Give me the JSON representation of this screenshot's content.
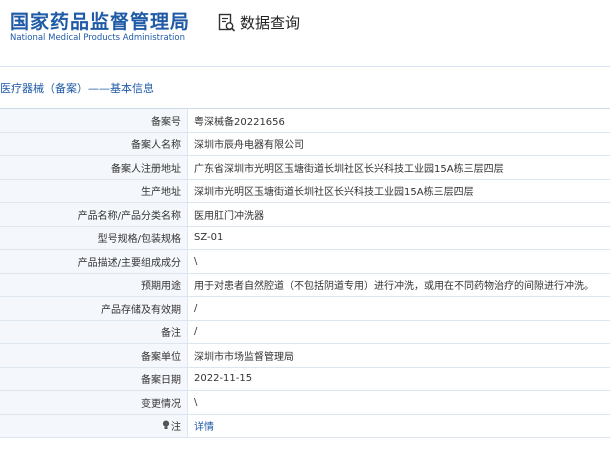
{
  "header": {
    "logo_cn": "国家药品监督管理局",
    "logo_en": "National Medical Products Administration",
    "query_label": "数据查询",
    "query_icon": "document-search-icon"
  },
  "section": {
    "title": "医疗器械（备案）——基本信息"
  },
  "rows": [
    {
      "label": "备案号",
      "value": "粤深械备20221656"
    },
    {
      "label": "备案人名称",
      "value": "深圳市辰舟电器有限公司"
    },
    {
      "label": "备案人注册地址",
      "value": "广东省深圳市光明区玉塘街道长圳社区长兴科技工业园15A栋三层四层"
    },
    {
      "label": "生产地址",
      "value": "深圳市光明区玉塘街道长圳社区长兴科技工业园15A栋三层四层"
    },
    {
      "label": "产品名称/产品分类名称",
      "value": "医用肛门冲洗器"
    },
    {
      "label": "型号规格/包装规格",
      "value": "SZ-01"
    },
    {
      "label": "产品描述/主要组成成分",
      "value": "\\"
    },
    {
      "label": "预期用途",
      "value": "用于对患者自然腔道（不包括阴道专用）进行冲洗，或用在不同药物治疗的间隙进行冲洗。"
    },
    {
      "label": "产品存储及有效期",
      "value": "/"
    },
    {
      "label": "备注",
      "value": "/"
    },
    {
      "label": "备案单位",
      "value": "深圳市市场监督管理局"
    },
    {
      "label": "备案日期",
      "value": "2022-11-15"
    },
    {
      "label": "变更情况",
      "value": "\\"
    }
  ],
  "note_row": {
    "label": "注",
    "icon": "bulb-icon",
    "link": "详情"
  }
}
